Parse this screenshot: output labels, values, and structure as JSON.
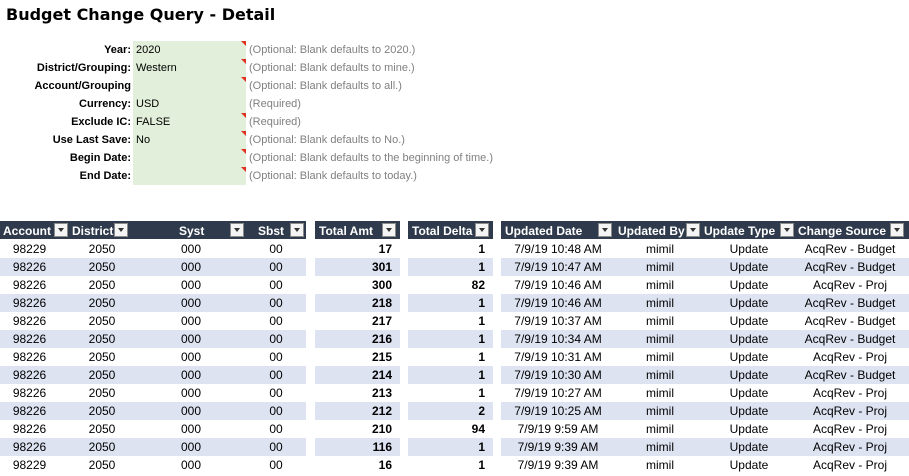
{
  "title": "Budget Change Query - Detail",
  "params": [
    {
      "label": "Year:",
      "value": "2020",
      "hint": "(Optional: Blank defaults to 2020.)",
      "flag": true
    },
    {
      "label": "District/Grouping:",
      "value": "Western",
      "hint": "(Optional: Blank defaults to mine.)",
      "flag": true
    },
    {
      "label": "Account/Grouping",
      "value": "",
      "hint": "(Optional: Blank defaults to all.)",
      "flag": true
    },
    {
      "label": "Currency:",
      "value": "USD",
      "hint": "(Required)",
      "flag": false
    },
    {
      "label": "Exclude IC:",
      "value": "FALSE",
      "hint": "(Required)",
      "flag": true
    },
    {
      "label": "Use Last Save:",
      "value": "No",
      "hint": "(Optional: Blank defaults to No.)",
      "flag": true
    },
    {
      "label": "Begin Date:",
      "value": "",
      "hint": "(Optional: Blank defaults to the beginning of time.)",
      "flag": true
    },
    {
      "label": "End Date:",
      "value": "",
      "hint": "(Optional: Blank defaults to today.)",
      "flag": true
    }
  ],
  "columns": {
    "account": "Account",
    "district": "District",
    "syst": "Syst",
    "sbst": "Sbst",
    "total_amt": "Total Amt",
    "total_delta": "Total Delta",
    "updated_date": "Updated Date",
    "updated_by": "Updated By",
    "update_type": "Update Type",
    "change_source": "Change Source"
  },
  "rows": [
    {
      "account": "98229",
      "district": "2050",
      "syst": "000",
      "sbst": "00",
      "total_amt": "17",
      "total_delta": "1",
      "updated_date": "7/9/19 10:48 AM",
      "updated_by": "mimil",
      "update_type": "Update",
      "change_source": "AcqRev - Budget"
    },
    {
      "account": "98226",
      "district": "2050",
      "syst": "000",
      "sbst": "00",
      "total_amt": "301",
      "total_delta": "1",
      "updated_date": "7/9/19 10:47 AM",
      "updated_by": "mimil",
      "update_type": "Update",
      "change_source": "AcqRev - Budget"
    },
    {
      "account": "98226",
      "district": "2050",
      "syst": "000",
      "sbst": "00",
      "total_amt": "300",
      "total_delta": "82",
      "updated_date": "7/9/19 10:46 AM",
      "updated_by": "mimil",
      "update_type": "Update",
      "change_source": "AcqRev - Proj"
    },
    {
      "account": "98226",
      "district": "2050",
      "syst": "000",
      "sbst": "00",
      "total_amt": "218",
      "total_delta": "1",
      "updated_date": "7/9/19 10:46 AM",
      "updated_by": "mimil",
      "update_type": "Update",
      "change_source": "AcqRev - Budget"
    },
    {
      "account": "98226",
      "district": "2050",
      "syst": "000",
      "sbst": "00",
      "total_amt": "217",
      "total_delta": "1",
      "updated_date": "7/9/19 10:37 AM",
      "updated_by": "mimil",
      "update_type": "Update",
      "change_source": "AcqRev - Budget"
    },
    {
      "account": "98226",
      "district": "2050",
      "syst": "000",
      "sbst": "00",
      "total_amt": "216",
      "total_delta": "1",
      "updated_date": "7/9/19 10:34 AM",
      "updated_by": "mimil",
      "update_type": "Update",
      "change_source": "AcqRev - Budget"
    },
    {
      "account": "98226",
      "district": "2050",
      "syst": "000",
      "sbst": "00",
      "total_amt": "215",
      "total_delta": "1",
      "updated_date": "7/9/19 10:31 AM",
      "updated_by": "mimil",
      "update_type": "Update",
      "change_source": "AcqRev - Proj"
    },
    {
      "account": "98226",
      "district": "2050",
      "syst": "000",
      "sbst": "00",
      "total_amt": "214",
      "total_delta": "1",
      "updated_date": "7/9/19 10:30 AM",
      "updated_by": "mimil",
      "update_type": "Update",
      "change_source": "AcqRev - Budget"
    },
    {
      "account": "98226",
      "district": "2050",
      "syst": "000",
      "sbst": "00",
      "total_amt": "213",
      "total_delta": "1",
      "updated_date": "7/9/19 10:27 AM",
      "updated_by": "mimil",
      "update_type": "Update",
      "change_source": "AcqRev - Proj"
    },
    {
      "account": "98226",
      "district": "2050",
      "syst": "000",
      "sbst": "00",
      "total_amt": "212",
      "total_delta": "2",
      "updated_date": "7/9/19 10:25 AM",
      "updated_by": "mimil",
      "update_type": "Update",
      "change_source": "AcqRev - Proj"
    },
    {
      "account": "98226",
      "district": "2050",
      "syst": "000",
      "sbst": "00",
      "total_amt": "210",
      "total_delta": "94",
      "updated_date": "7/9/19 9:59 AM",
      "updated_by": "mimil",
      "update_type": "Update",
      "change_source": "AcqRev - Proj"
    },
    {
      "account": "98226",
      "district": "2050",
      "syst": "000",
      "sbst": "00",
      "total_amt": "116",
      "total_delta": "1",
      "updated_date": "7/9/19 9:39 AM",
      "updated_by": "mimil",
      "update_type": "Update",
      "change_source": "AcqRev - Proj"
    },
    {
      "account": "98229",
      "district": "2050",
      "syst": "000",
      "sbst": "00",
      "total_amt": "16",
      "total_delta": "1",
      "updated_date": "7/9/19 9:39 AM",
      "updated_by": "mimil",
      "update_type": "Update",
      "change_source": "AcqRev - Proj"
    }
  ],
  "colors": {
    "header_bg": "#2f3b4c",
    "param_fill": "#e2efda",
    "row_alt": "#dde3f1",
    "hint": "#808080"
  }
}
